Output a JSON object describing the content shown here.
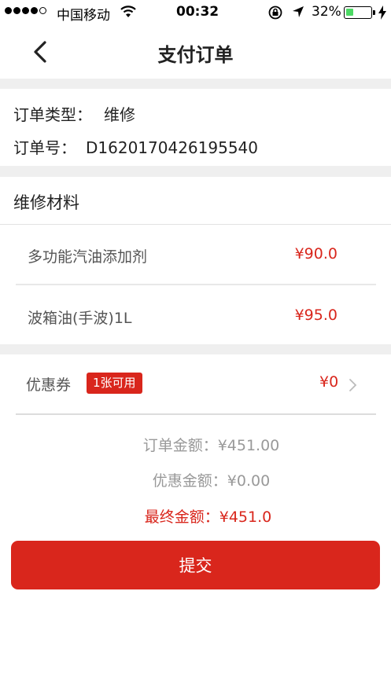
{
  "status_bar": {
    "carrier": "中国移动",
    "time": "00:32",
    "battery_percent": "32%",
    "battery_level": 0.32
  },
  "nav": {
    "title": "支付订单",
    "back_icon": "chevron-left-icon"
  },
  "order": {
    "type_label": "订单类型：",
    "type_value": "维修",
    "number_label": "订单号：",
    "number_value": "D1620170426195540"
  },
  "materials": {
    "title": "维修材料",
    "items": [
      {
        "name": "多功能汽油添加剂",
        "price": "¥90.0"
      },
      {
        "name": "波箱油(手波)1L",
        "price": "¥95.0"
      }
    ]
  },
  "coupon": {
    "label": "优惠券",
    "badge": "1张可用",
    "value": "¥0",
    "icon": "chevron-right-icon"
  },
  "summary": {
    "order_amount": "订单金额：¥451.00",
    "discount_amount": "优惠金额：¥0.00",
    "final_amount": "最终金额：¥451.0"
  },
  "submit_label": "提交",
  "colors": {
    "accent": "#d9261c",
    "divider_bg": "#efefef"
  }
}
